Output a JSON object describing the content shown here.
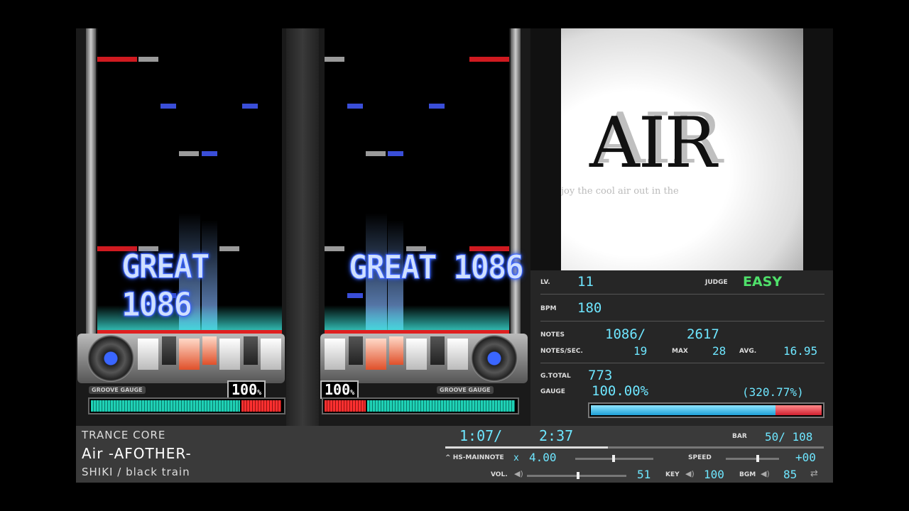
{
  "playfield": {
    "judgement": "GREAT",
    "combo": "1086",
    "groove_gauge_label": "GROOVE GAUGE",
    "gauge_percent": "100",
    "percent_sign": "%"
  },
  "jacket": {
    "title_art": "AIR",
    "subtitle_art": "joy the cool air out in the"
  },
  "info": {
    "lv_label": "LV.",
    "lv_value": "11",
    "judge_label": "JUDGE",
    "judge_value": "EASY",
    "bpm_label": "BPM",
    "bpm_value": "180",
    "notes_label": "NOTES",
    "notes_value": "1086/",
    "notes_total": "2617",
    "nps_label": "NOTES/SEC.",
    "nps_value": "19",
    "max_label": "MAX",
    "max_value": "28",
    "avg_label": "AVG.",
    "avg_value": "16.95",
    "gtotal_label": "G.TOTAL",
    "gtotal_value": "773",
    "gauge_label": "GAUGE",
    "gauge_value": "100.00%",
    "gauge_extra": "(320.77%)",
    "gauge_fill": 0.8
  },
  "song": {
    "genre": "TRANCE CORE",
    "title": "Air -AFOTHER-",
    "artist": "SHIKI / black train"
  },
  "status": {
    "time_current": "1:07/",
    "time_total": "2:37",
    "progress": 0.43,
    "bar_label": "BAR",
    "bar_value": "50/ 108",
    "hs_label": "HS-MAINNOTE",
    "hs_mult": "x",
    "hs_value": "4.00",
    "speed_label": "SPEED",
    "speed_value": "+00",
    "vol_label": "VOL.",
    "vol_value": "51",
    "key_label": "KEY",
    "key_value": "100",
    "bgm_label": "BGM",
    "bgm_value": "85"
  },
  "colors": {
    "cyan_text": "#6ee6ff",
    "easy_green": "#4fe06a",
    "note_blue": "#3a4ed8",
    "note_red": "#d01a20"
  }
}
